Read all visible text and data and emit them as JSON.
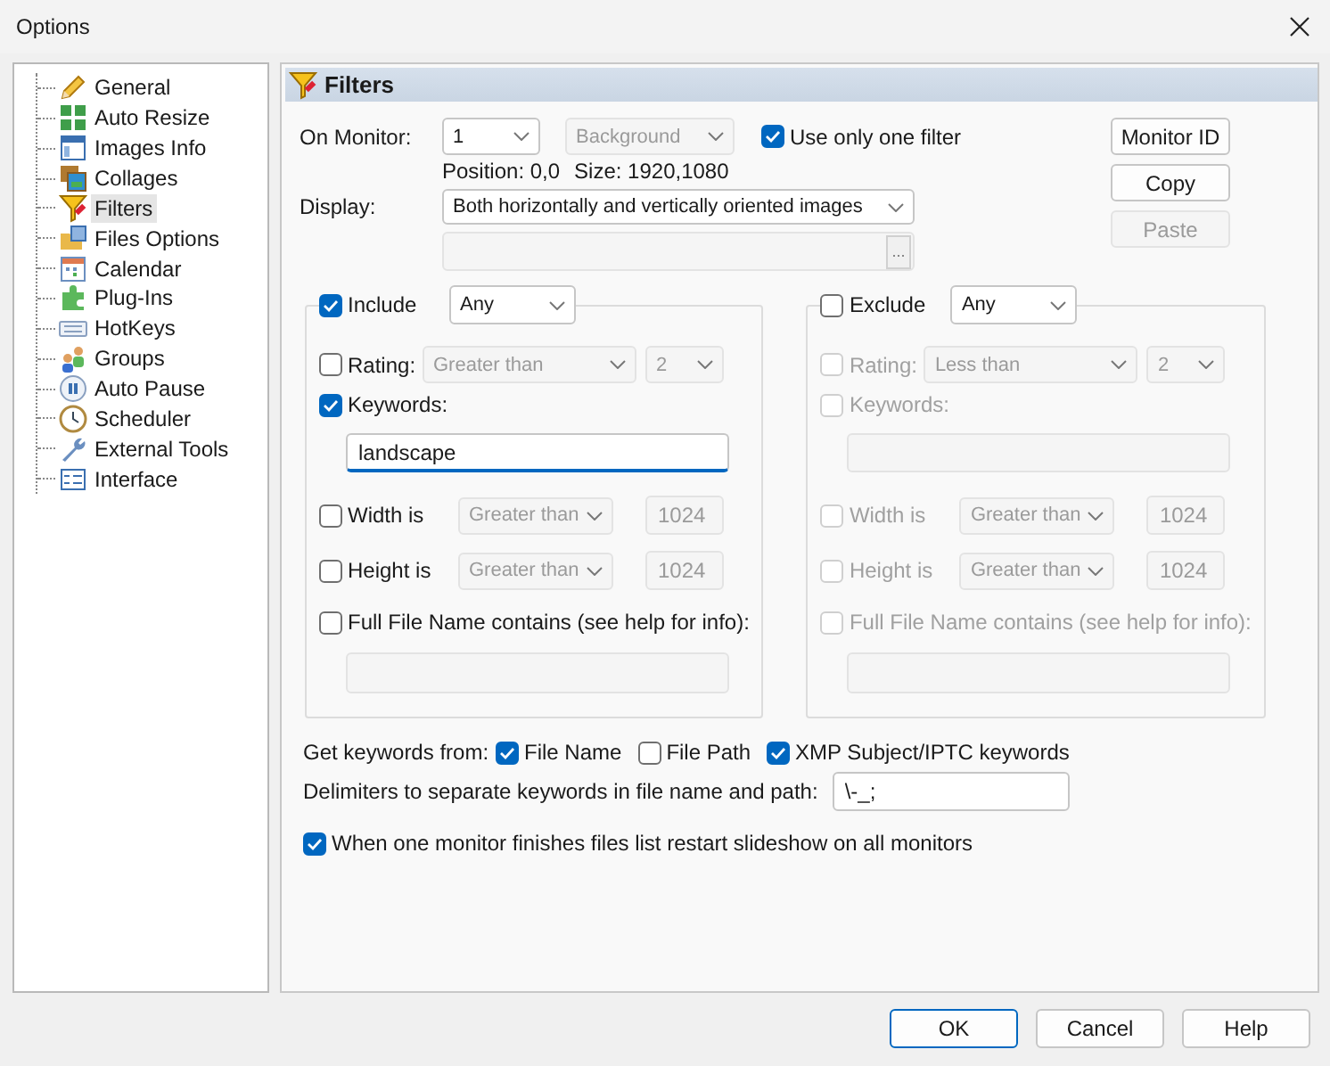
{
  "window": {
    "title": "Options"
  },
  "sidebar": {
    "items": [
      {
        "label": "General",
        "selected": false
      },
      {
        "label": "Auto Resize",
        "selected": false
      },
      {
        "label": "Images Info",
        "selected": false
      },
      {
        "label": "Collages",
        "selected": false
      },
      {
        "label": "Filters",
        "selected": true
      },
      {
        "label": "Files Options",
        "selected": false
      },
      {
        "label": "Calendar",
        "selected": false
      },
      {
        "label": "Plug-Ins",
        "selected": false
      },
      {
        "label": "HotKeys",
        "selected": false
      },
      {
        "label": "Groups",
        "selected": false
      },
      {
        "label": "Auto Pause",
        "selected": false
      },
      {
        "label": "Scheduler",
        "selected": false
      },
      {
        "label": "External Tools",
        "selected": false
      },
      {
        "label": "Interface",
        "selected": false
      }
    ]
  },
  "page": {
    "title": "Filters"
  },
  "monitor": {
    "label": "On Monitor:",
    "value": "1",
    "mode": {
      "value": "Background",
      "disabled": true
    },
    "use_only_one_filter": {
      "label": "Use only one filter",
      "checked": true
    }
  },
  "position": "Position: 0,0",
  "size": "Size: 1920,1080",
  "display": {
    "label": "Display:",
    "value": "Both horizontally and vertically oriented images",
    "browse": "..."
  },
  "side_buttons": [
    {
      "label": "Monitor ID",
      "disabled": false
    },
    {
      "label": "Copy",
      "disabled": false
    },
    {
      "label": "Paste",
      "disabled": true
    }
  ],
  "groups": [
    {
      "label": "Include",
      "checked": true,
      "match": "Any",
      "rating": {
        "label": "Rating:",
        "checked": false,
        "comparison": "Greater than",
        "value": "2"
      },
      "keywords": {
        "label": "Keywords:",
        "checked": true,
        "value": "landscape"
      },
      "width": {
        "label": "Width is",
        "checked": false,
        "comparison": "Greater than",
        "value": "1024"
      },
      "height": {
        "label": "Height is",
        "checked": false,
        "comparison": "Greater than",
        "value": "1024"
      },
      "full_file_name": {
        "label": "Full File Name contains (see help for info):",
        "checked": false
      }
    },
    {
      "label": "Exclude",
      "checked": false,
      "match": "Any",
      "rating": {
        "label": "Rating:",
        "checked": false,
        "comparison": "Less than",
        "value": "2"
      },
      "keywords": {
        "label": "Keywords:",
        "checked": false
      },
      "width": {
        "label": "Width is",
        "checked": false,
        "comparison": "Greater than",
        "value": "1024"
      },
      "height": {
        "label": "Height is",
        "checked": false,
        "comparison": "Greater than",
        "value": "1024"
      },
      "full_file_name": {
        "label": "Full File Name contains (see help for info):",
        "checked": false
      }
    }
  ],
  "keyword_sources": {
    "label": "Get keywords from:",
    "options": [
      {
        "label": "File Name",
        "checked": true
      },
      {
        "label": "File Path",
        "checked": false
      },
      {
        "label": "XMP Subject/IPTC keywords",
        "checked": true
      }
    ]
  },
  "delimiters": {
    "label": "Delimiters to separate keywords in file name and path:",
    "value": "\\-_;"
  },
  "restart_all": {
    "label": "When one monitor finishes files list restart slideshow on all monitors",
    "checked": true
  },
  "buttons": [
    {
      "label": "OK",
      "default": true
    },
    {
      "label": "Cancel",
      "default": false
    },
    {
      "label": "Help",
      "default": false
    }
  ]
}
